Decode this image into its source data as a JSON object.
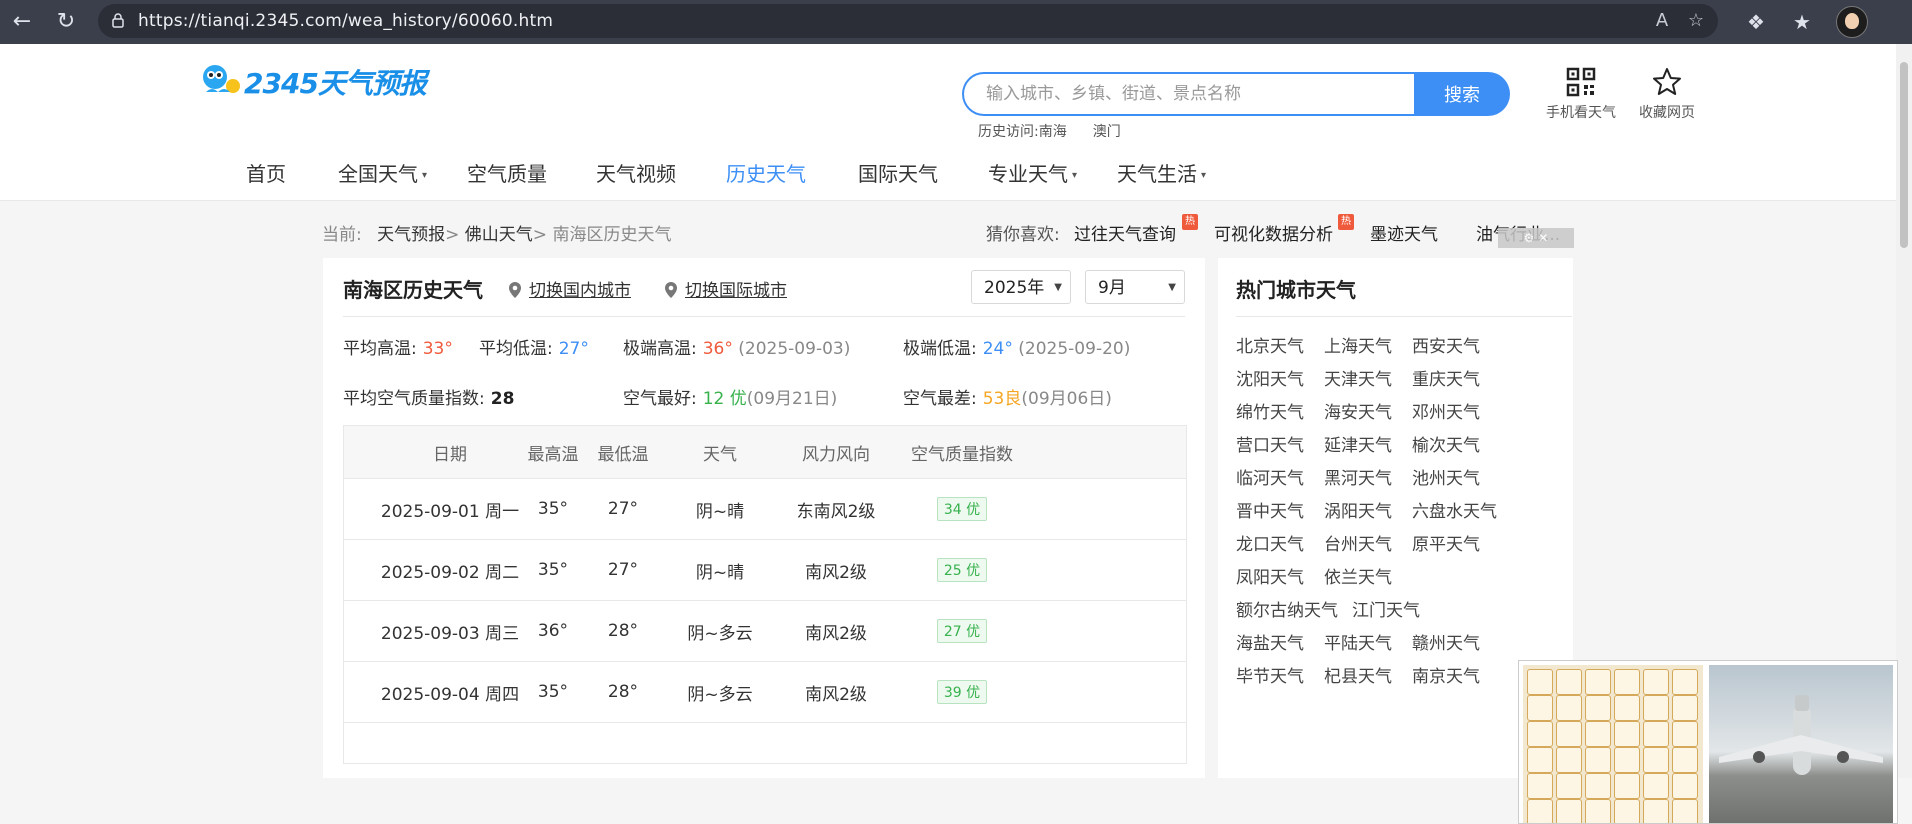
{
  "browser": {
    "url": "https://tianqi.2345.com/wea_history/60060.htm",
    "icons": [
      "back-icon",
      "refresh-icon",
      "lock-icon",
      "read-aloud-icon",
      "favorite-star-icon",
      "extensions-icon",
      "favorites-icon",
      "profile-avatar"
    ]
  },
  "header": {
    "brand": "2345天气预报",
    "search_placeholder": "输入城市、乡镇、街道、景点名称",
    "search_button": "搜索",
    "history_label": "历史访问:南海",
    "history_item2": "澳门",
    "mobile_label": "手机看天气",
    "bookmark_label": "收藏网页"
  },
  "nav": {
    "home": "首页",
    "national": "全国天气",
    "air": "空气质量",
    "video": "天气视频",
    "history": "历史天气",
    "international": "国际天气",
    "pro": "专业天气",
    "life": "天气生活",
    "caret": "▾"
  },
  "breadcrumb": {
    "prefix": "当前:",
    "l1": "天气预报",
    "l2": "佛山天气",
    "current": "南海区历史天气",
    "sep": ">"
  },
  "guess": {
    "label": "猜你喜欢:",
    "i1": "过往天气查询",
    "i2": "可视化数据分析",
    "i3": "墨迹天气",
    "i4": "油气行业...",
    "hot": "热"
  },
  "panel": {
    "title": "南海区历史天气",
    "switch_domestic": "切换国内城市",
    "switch_intl": "切换国际城市",
    "year": "2025年",
    "month": "9月"
  },
  "stats": {
    "avg_high_label": "平均高温:",
    "avg_high": "33°",
    "avg_low_label": "平均低温:",
    "avg_low": "27°",
    "max_high_label": "极端高温:",
    "max_high": "36°",
    "max_high_date": "(2025-09-03)",
    "min_low_label": "极端低温:",
    "min_low": "24°",
    "min_low_date": "(2025-09-20)",
    "aqi_label": "平均空气质量指数:",
    "aqi": "28",
    "best_label": "空气最好:",
    "best": "12 优",
    "best_date": "(09月21日)",
    "worst_label": "空气最差:",
    "worst": "53良",
    "worst_date": "(09月06日)"
  },
  "table": {
    "headers": [
      "日期",
      "最高温",
      "最低温",
      "天气",
      "风力风向",
      "空气质量指数"
    ],
    "rows": [
      {
        "date": "2025-09-01 周一",
        "high": "35°",
        "low": "27°",
        "weather": "阴~晴",
        "wind": "东南风2级",
        "aqi": "34 优"
      },
      {
        "date": "2025-09-02 周二",
        "high": "35°",
        "low": "27°",
        "weather": "阴~晴",
        "wind": "南风2级",
        "aqi": "25 优"
      },
      {
        "date": "2025-09-03 周三",
        "high": "36°",
        "low": "28°",
        "weather": "阴~多云",
        "wind": "南风2级",
        "aqi": "27 优"
      },
      {
        "date": "2025-09-04 周四",
        "high": "35°",
        "low": "28°",
        "weather": "阴~多云",
        "wind": "南风2级",
        "aqi": "39 优"
      }
    ]
  },
  "hot_cities": {
    "title": "热门城市天气",
    "cities": [
      "北京天气",
      "上海天气",
      "西安天气",
      "沈阳天气",
      "天津天气",
      "重庆天气",
      "绵竹天气",
      "海安天气",
      "邓州天气",
      "营口天气",
      "延津天气",
      "榆次天气",
      "临河天气",
      "黑河天气",
      "池州天气",
      "晋中天气",
      "涡阳天气",
      "六盘水天气",
      "龙口天气",
      "台州天气",
      "原平天气",
      "凤阳天气",
      "依兰天气",
      "额尔古纳天气",
      "江门天气",
      "海盐天气",
      "平陆天气",
      "赣州天气",
      "毕节天气",
      "杞县天气",
      "南京天气"
    ]
  },
  "colors": {
    "accent": "#3d8ff5",
    "hot_red": "#f05a3c",
    "good_green": "#37b24d",
    "moderate_orange": "#f5a623"
  }
}
